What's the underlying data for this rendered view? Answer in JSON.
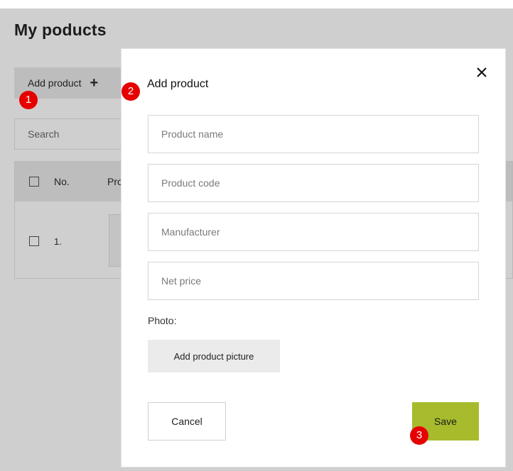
{
  "page": {
    "title": "My poducts",
    "add_product_label": "Add product",
    "add_product_icon": "plus-icon",
    "search_placeholder": "Search",
    "table": {
      "headers": [
        "No.",
        "Pro"
      ],
      "rows": [
        {
          "no": "1."
        }
      ]
    }
  },
  "modal": {
    "title": "Add product",
    "close_icon": "close-icon",
    "fields": {
      "product_name_placeholder": "Product name",
      "product_code_placeholder": "Product code",
      "manufacturer_placeholder": "Manufacturer",
      "net_price_placeholder": "Net price"
    },
    "photo_label": "Photo:",
    "add_picture_label": "Add product picture",
    "cancel_label": "Cancel",
    "save_label": "Save"
  },
  "steps": [
    "1",
    "2",
    "3"
  ],
  "colors": {
    "overlay_background": "#cfcfcf",
    "save_button": "#a7bb2d",
    "step_marker": "#e60000"
  }
}
